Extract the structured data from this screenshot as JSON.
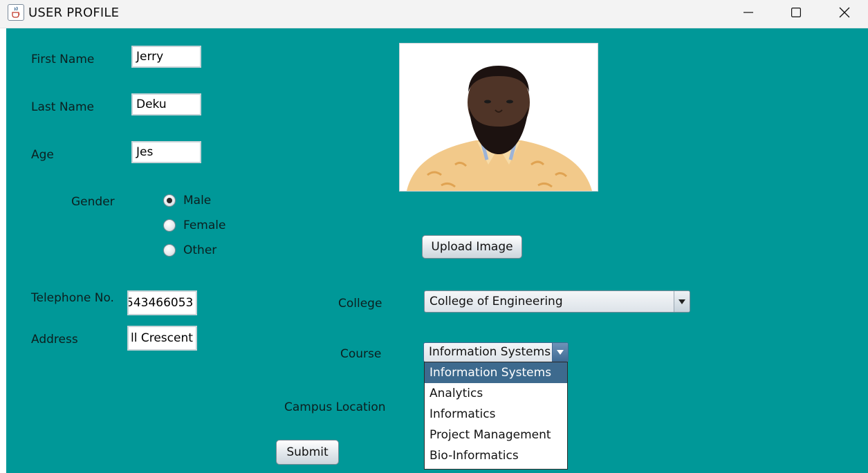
{
  "window": {
    "title": "USER PROFILE",
    "icon": "java-cup-icon"
  },
  "form": {
    "first_name": {
      "label": "First Name",
      "value": "Jerry"
    },
    "last_name": {
      "label": "Last Name",
      "value": "Deku"
    },
    "age": {
      "label": "Age",
      "value": "Jes"
    },
    "gender": {
      "label": "Gender",
      "options": [
        "Male",
        "Female",
        "Other"
      ],
      "selected": "Male"
    },
    "telephone": {
      "label": "Telephone No.",
      "value": "543466053"
    },
    "address": {
      "label": "Address",
      "value": "ll Crescent"
    },
    "college": {
      "label": "College",
      "value": "College of Engineering"
    },
    "course": {
      "label": "Course",
      "value": "Information Systems",
      "options": [
        "Information Systems",
        "Analytics",
        "Informatics",
        "Project Management",
        "Bio-Informatics"
      ],
      "highlighted": "Information Systems"
    },
    "campus": {
      "label": "Campus Location"
    }
  },
  "buttons": {
    "upload": "Upload Image",
    "submit": "Submit"
  },
  "colors": {
    "background": "#009898",
    "highlight": "#3d6a8e"
  }
}
